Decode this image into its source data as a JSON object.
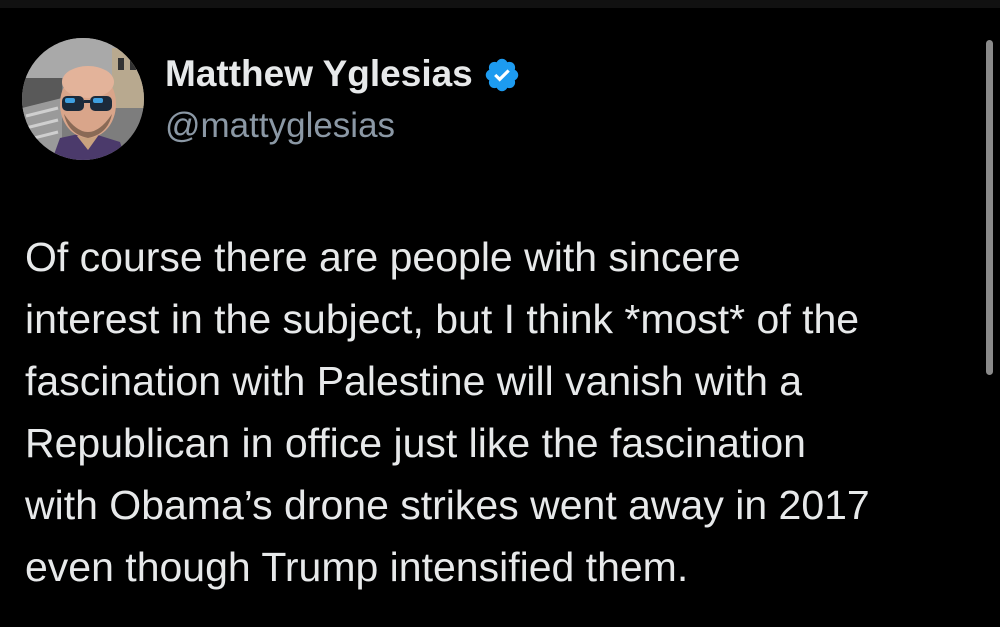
{
  "tweet": {
    "author": {
      "display_name": "Matthew Yglesias",
      "handle": "@mattyglesias",
      "verified": true,
      "avatar_icon": "profile-photo"
    },
    "text_lines": [
      "Of course there are people with sincere",
      "interest in the subject, but I think *most* of the",
      "fascination with Palestine will vanish with a",
      "Republican in office just like the fascination",
      "with Obama’s drone strikes went away in 2017",
      "even though Trump intensified them."
    ]
  },
  "colors": {
    "background": "#000000",
    "text": "#e7e9ea",
    "handle": "#8b98a5",
    "verified_badge": "#1d9bf0"
  }
}
